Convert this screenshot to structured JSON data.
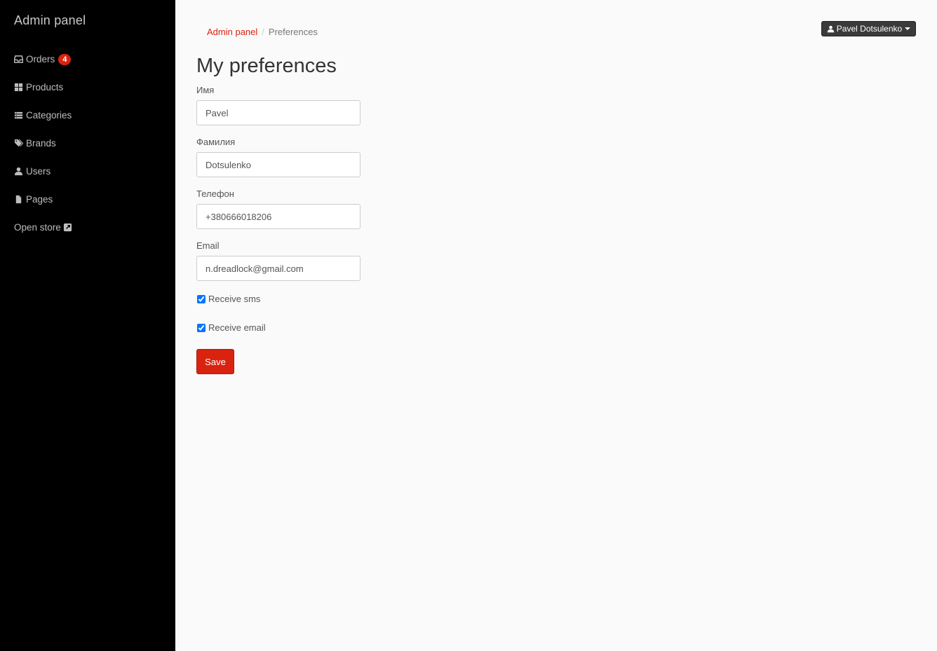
{
  "sidebar": {
    "brand": "Admin panel",
    "items": [
      {
        "label": "Orders",
        "icon": "inbox-icon",
        "badge": "4"
      },
      {
        "label": "Products",
        "icon": "grid-icon"
      },
      {
        "label": "Categories",
        "icon": "list-icon"
      },
      {
        "label": "Brands",
        "icon": "tags-icon"
      },
      {
        "label": "Users",
        "icon": "user-icon"
      },
      {
        "label": "Pages",
        "icon": "file-icon"
      },
      {
        "label": "Open store",
        "icon": "external-link-icon"
      }
    ]
  },
  "breadcrumb": {
    "root": "Admin panel",
    "current": "Preferences"
  },
  "header": {
    "user_name": "Pavel Dotsulenko"
  },
  "page_title": "My preferences",
  "form": {
    "first_name": {
      "label": "Имя",
      "value": "Pavel"
    },
    "last_name": {
      "label": "Фамилия",
      "value": "Dotsulenko"
    },
    "phone": {
      "label": "Телефон",
      "value": "+380666018206"
    },
    "email": {
      "label": "Email",
      "value": "n.dreadlock@gmail.com"
    },
    "receive_sms": {
      "label": "Receive sms",
      "checked": true
    },
    "receive_email": {
      "label": "Receive email",
      "checked": true
    },
    "save_label": "Save"
  },
  "colors": {
    "accent": "#d9230f",
    "sidebar_bg": "#000000",
    "page_bg": "#fafafa"
  }
}
